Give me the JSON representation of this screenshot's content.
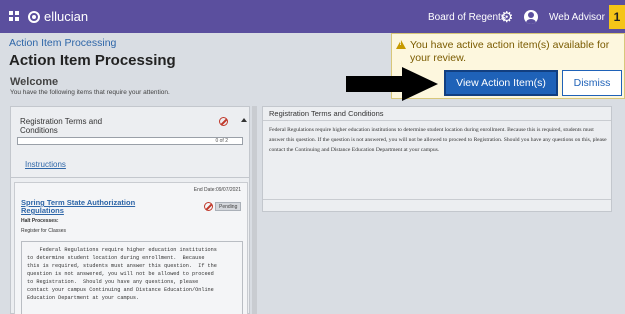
{
  "header": {
    "brand": "ellucian",
    "institution": "Board of Regents",
    "user": "Web Advisor",
    "notification_count": "1",
    "colors": {
      "bar": "#5b4f9e",
      "badge": "#f5c518"
    }
  },
  "page": {
    "breadcrumb": "Action Item Processing",
    "title": "Action Item Processing",
    "welcome": "Welcome",
    "welcome_sub": "You have the following items that require your attention."
  },
  "left_panel": {
    "group_title": "Registration Terms and Conditions",
    "progress_text": "0 of 2",
    "instructions_link": "Instructions",
    "item": {
      "end_date": "End Date:09/07/2021",
      "title": "Spring Term State Authorization Regulations",
      "status": "Pending",
      "halt_label": "Halt Processes:",
      "halt_item": "Register for Classes",
      "message": "    Federal Regulations require higher education institutions\nto determine student location during enrollment.  Because\nthis is required, students must answer this question.  If the\nquestion is not answered, you will not be allowed to proceed\nto Registration.  Should you have any questions, please\ncontact your campus Continuing and Distance Education/Online\nEducation Department at your campus."
    }
  },
  "right_panel": {
    "title": "Registration Terms and Conditions",
    "body": "Federal Regulations require higher education institutions to determine student location during enrollment.  Because this is required, students must answer this question.  If the question is not answered, you will not be allowed to proceed to Registration. Should you have any questions on this, please contact the Continuing and Distance Education Department at your campus."
  },
  "popup": {
    "message": "You have active action item(s) available for your review.",
    "view_button": "View Action Item(s)",
    "dismiss_button": "Dismiss",
    "colors": {
      "primary": "#1f62b8",
      "warning_bg": "#fdf7de"
    }
  }
}
